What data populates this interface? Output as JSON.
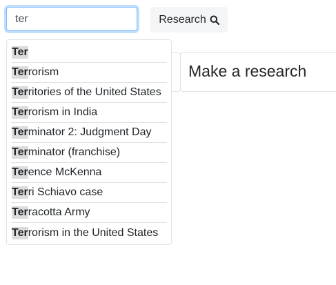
{
  "search": {
    "value": "ter",
    "button_label": "Research"
  },
  "card": {
    "title": "Make a research"
  },
  "suggestions": [
    {
      "match": "Ter",
      "rest": ""
    },
    {
      "match": "Ter",
      "rest": "rorism"
    },
    {
      "match": "Ter",
      "rest": "ritories of the United States"
    },
    {
      "match": "Ter",
      "rest": "rorism in India"
    },
    {
      "match": "Ter",
      "rest": "minator 2: Judgment Day"
    },
    {
      "match": "Ter",
      "rest": "minator (franchise)"
    },
    {
      "match": "Ter",
      "rest": "ence McKenna"
    },
    {
      "match": "Ter",
      "rest": "ri Schiavo case"
    },
    {
      "match": "Ter",
      "rest": "racotta Army"
    },
    {
      "match": "Ter",
      "rest": "rorism in the United States"
    }
  ],
  "colors": {
    "focus_border": "#80bdff",
    "highlight": "#dcdcdc",
    "button_bg": "#f4f5f7"
  },
  "icons": {
    "button_icon": "search-icon"
  }
}
